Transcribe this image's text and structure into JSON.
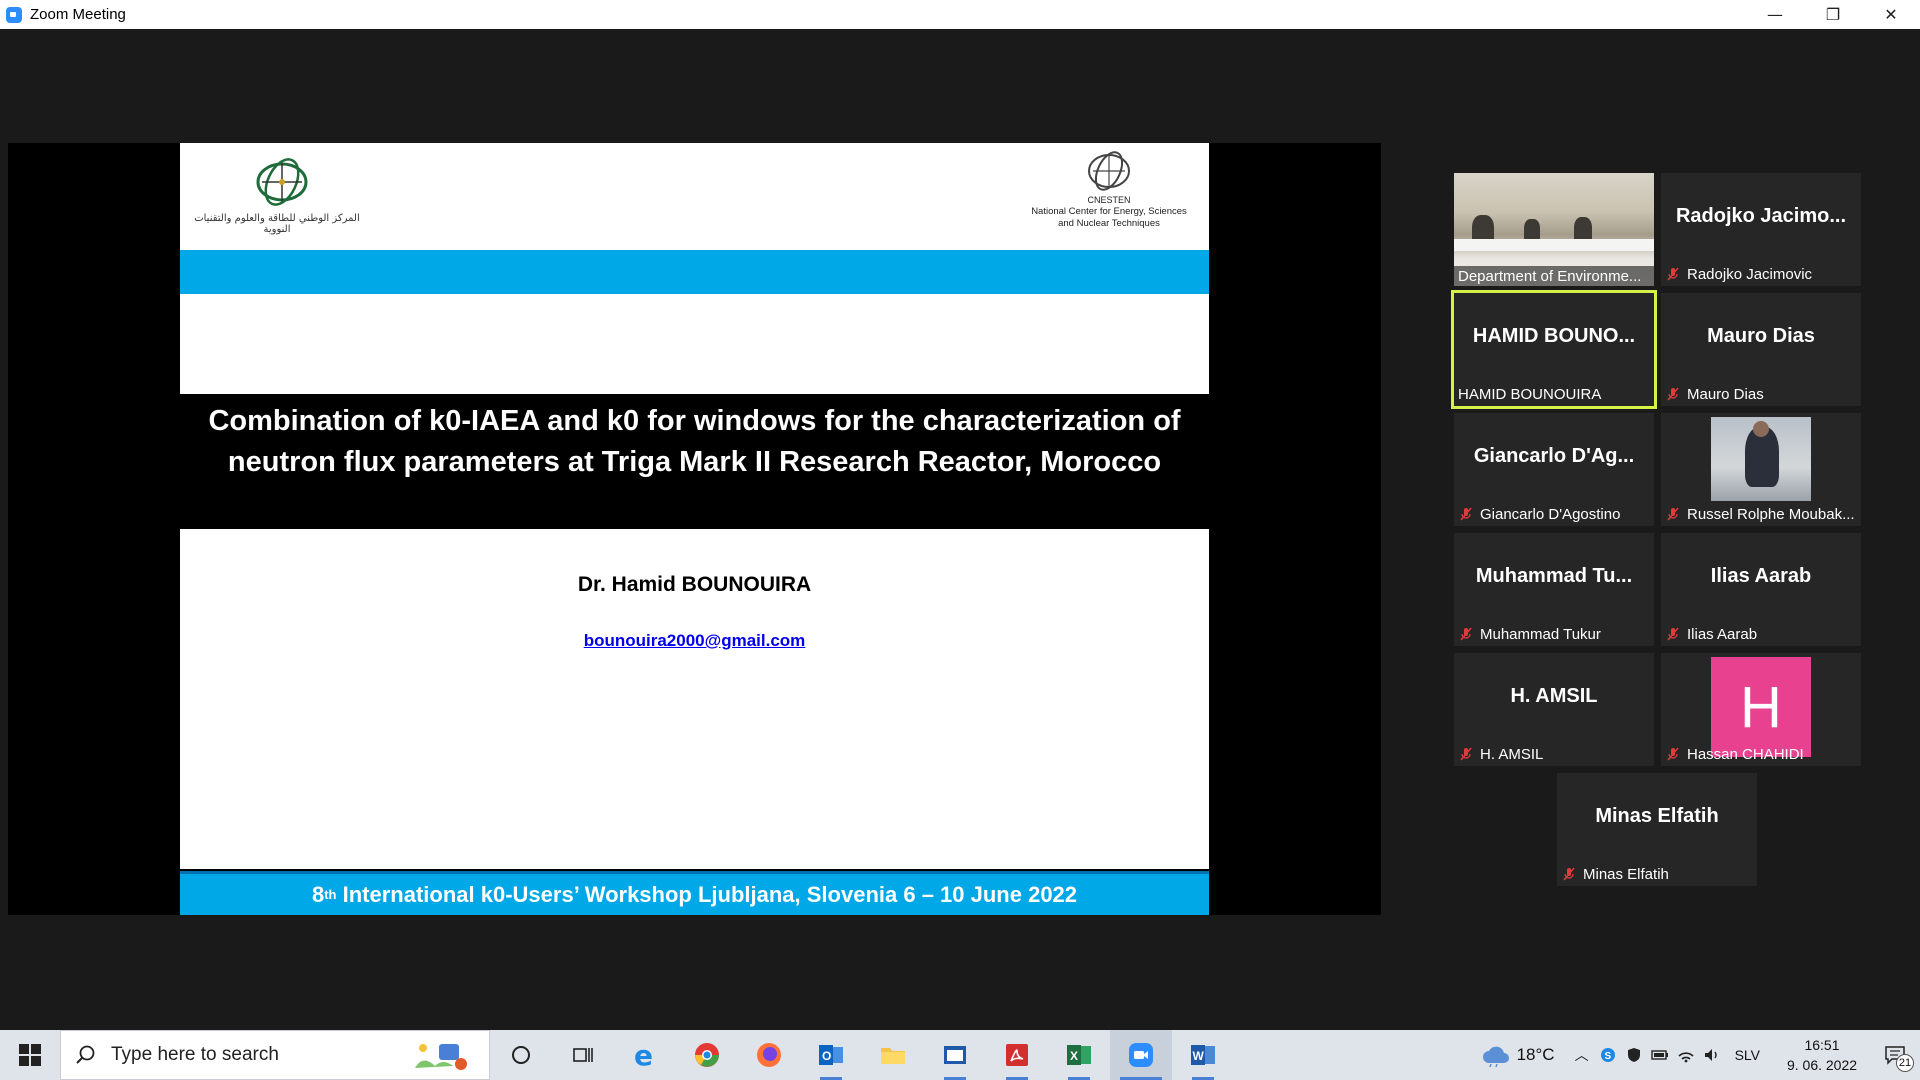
{
  "window": {
    "title": "Zoom Meeting",
    "controls": {
      "minimize": "—",
      "restore": "❐",
      "close": "✕"
    }
  },
  "slide": {
    "logo_left_text": "المركز الوطني للطاقة والعلوم والتقنيات النووية",
    "logo_right_abbr": "CNESTEN",
    "logo_right_line1": "National Center for Energy, Sciences",
    "logo_right_line2": "and Nuclear Techniques",
    "title_line1": "Combination of k0-IAEA and k0 for windows for the characterization of",
    "title_line2": "neutron flux parameters at Triga Mark II Research Reactor, Morocco",
    "author": "Dr. Hamid BOUNOUIRA",
    "email": "bounouira2000@gmail.com",
    "footer_pre": "8",
    "footer_sup": "th",
    "footer_post": " International k0-Users’ Workshop Ljubljana, Slovenia 6 – 10 June 2022"
  },
  "participants": [
    {
      "display": "",
      "label": "Department of Environme..."
    },
    {
      "display": "Radojko  Jacimo...",
      "label": "Radojko Jacimovic"
    },
    {
      "display": "HAMID  BOUNO...",
      "label": "HAMID BOUNOUIRA"
    },
    {
      "display": "Mauro Dias",
      "label": "Mauro Dias"
    },
    {
      "display": "Giancarlo  D'Ag...",
      "label": "Giancarlo D'Agostino"
    },
    {
      "display": "",
      "label": "Russel Rolphe Moubak..."
    },
    {
      "display": "Muhammad  Tu...",
      "label": "Muhammad Tukur"
    },
    {
      "display": "Ilias Aarab",
      "label": "Ilias Aarab"
    },
    {
      "display": "H. AMSIL",
      "label": "H. AMSIL"
    },
    {
      "display": "H",
      "label": "Hassan CHAHIDI"
    },
    {
      "display": "Minas Elfatih",
      "label": "Minas Elfatih"
    }
  ],
  "taskbar": {
    "search_placeholder": "Type here to search",
    "temperature": "18°C",
    "language": "SLV",
    "time": "16:51",
    "date": "9. 06. 2022",
    "notification_count": "21"
  },
  "colors": {
    "slide_blue": "#00a8e8",
    "active_speaker": "#d6f04a",
    "avatar_h": "#e8418f",
    "mute_red": "#e0393e"
  }
}
